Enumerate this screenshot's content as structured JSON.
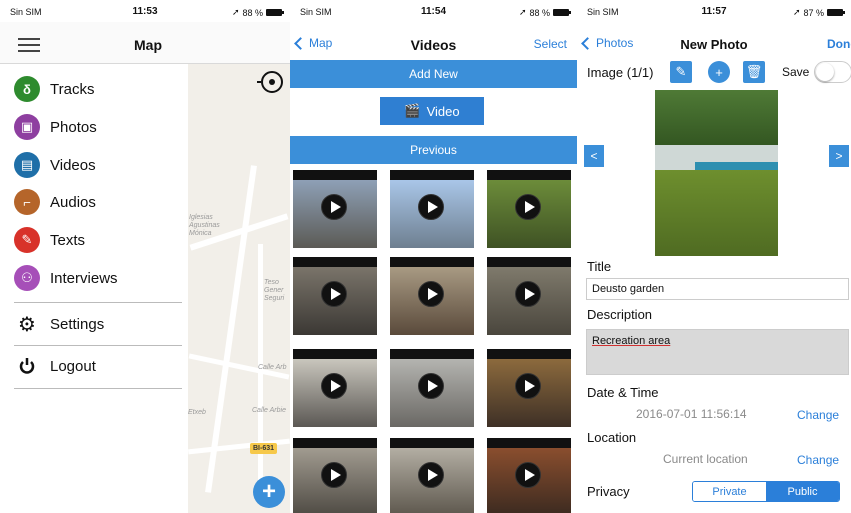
{
  "screen1": {
    "status": {
      "carrier": "Sin SIM",
      "time": "11:53",
      "battery": "88 %"
    },
    "title": "Map",
    "menu": [
      {
        "label": "Tracks",
        "icon": "tracks-icon",
        "color": "#2e8b2e",
        "glyph": "δ"
      },
      {
        "label": "Photos",
        "icon": "photos-icon",
        "color": "#8e3fa0",
        "glyph": "▣"
      },
      {
        "label": "Videos",
        "icon": "videos-icon",
        "color": "#1f6fa8",
        "glyph": "▤"
      },
      {
        "label": "Audios",
        "icon": "audios-icon",
        "color": "#b5652a",
        "glyph": "⌐"
      },
      {
        "label": "Texts",
        "icon": "texts-icon",
        "color": "#d8322a",
        "glyph": "✎"
      },
      {
        "label": "Interviews",
        "icon": "interviews-icon",
        "color": "#a64fb8",
        "glyph": "⚇"
      }
    ],
    "settings": "Settings",
    "logout": "Logout",
    "map": {
      "badge": "BI-631",
      "labels": [
        "Iglesias",
        "Agustinas",
        "Mónica",
        "Teso",
        "Gener",
        "Seguri",
        "Calle Arb",
        "Calle Arbie",
        "Etxeb"
      ]
    }
  },
  "screen2": {
    "status": {
      "carrier": "Sin SIM",
      "time": "11:54",
      "battery": "88 %"
    },
    "back": "Map",
    "title": "Videos",
    "action": "Select",
    "add_new": "Add New",
    "video_button": "Video",
    "previous": "Previous"
  },
  "screen3": {
    "status": {
      "carrier": "Sin SIM",
      "time": "11:57",
      "battery": "87 %"
    },
    "back": "Photos",
    "title": "New Photo",
    "action": "Done",
    "image_label": "Image (1/1)",
    "save_label": "Save",
    "prev_arrow": "<",
    "next_arrow": ">",
    "title_label": "Title",
    "title_value": "Deusto garden",
    "description_label": "Description",
    "description_value": "Recreation area",
    "datetime_label": "Date & Time",
    "datetime_value": "2016-07-01 11:56:14",
    "change1": "Change",
    "location_label": "Location",
    "location_value": "Current location",
    "change2": "Change",
    "privacy_label": "Privacy",
    "privacy_options": [
      "Private",
      "Public"
    ],
    "privacy_selected": "Public"
  }
}
